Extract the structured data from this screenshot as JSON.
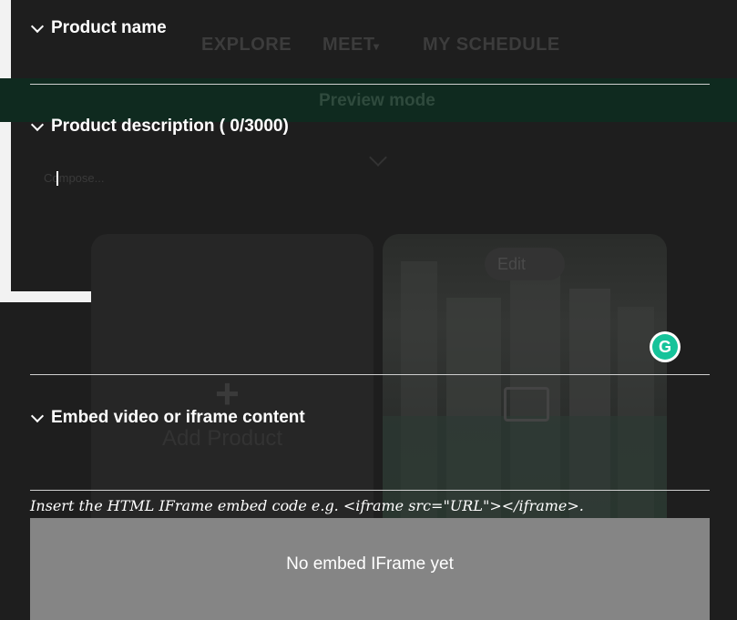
{
  "background": {
    "nav": [
      "EXPLORE",
      "MEET",
      "MY SCHEDULE"
    ],
    "nav_meet_caret": "▾",
    "preview_banner": "Preview mode",
    "compose_placeholder": "Compose...",
    "add_product_label": "Add Product",
    "add_product_plus": "+",
    "edit_label": "Edit",
    "edit_icon": "pencil-icon"
  },
  "panel": {
    "sections": [
      {
        "title": "Product name"
      },
      {
        "title": "Product description ( 0/3000)"
      },
      {
        "title": "Embed video or iframe content"
      }
    ],
    "instruction": "Insert the HTML IFrame embed code e.g. <iframe src=\"URL\"></iframe>.",
    "embed_preview_text": "No embed IFrame yet",
    "grammarly_letter": "G"
  },
  "colors": {
    "panel_background": "#1c1c1c",
    "embed_preview_bg": "#858585",
    "grammarly_green": "#15c39a",
    "divider": "#cfcfcf"
  }
}
